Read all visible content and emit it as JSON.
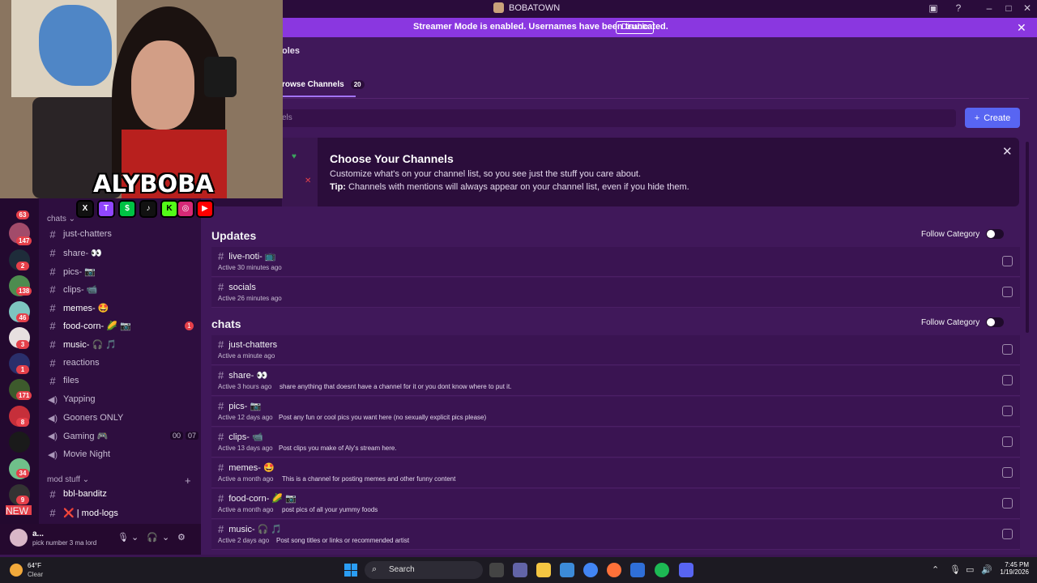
{
  "window": {
    "title": "BOBATOWN"
  },
  "banner": {
    "message": "Streamer Mode is enabled. Usernames have been truncated.",
    "disable_label": "Disable"
  },
  "header": {
    "tab_partial": "oles",
    "browse_tab_label": "rowse Channels",
    "browse_tab_count": "20",
    "search_placeholder": "els",
    "create_label": "Create"
  },
  "promo": {
    "title": "Choose Your Channels",
    "description": "Customize what's on your channel list, so you see just the stuff you care about.",
    "tip_label": "Tip:",
    "tip_text": "Channels with mentions will always appear on your channel list, even if you hide them."
  },
  "sections": [
    {
      "title": "Updates",
      "follow_label": "Follow Category",
      "rows": [
        {
          "name": "live-noti- 📺",
          "active": "Active 30 minutes ago",
          "topic": ""
        },
        {
          "name": "socials",
          "active": "Active 26 minutes ago",
          "topic": ""
        }
      ]
    },
    {
      "title": "chats",
      "follow_label": "Follow Category",
      "rows": [
        {
          "name": "just-chatters",
          "active": "Active a minute ago",
          "topic": ""
        },
        {
          "name": "share- 👀",
          "active": "Active 3 hours ago",
          "topic": "share anything that doesnt have a channel for it or you dont know where to put it."
        },
        {
          "name": "pics- 📷",
          "active": "Active 12 days ago",
          "topic": "Post any fun or cool pics you want here (no sexually explicit pics please)"
        },
        {
          "name": "clips- 📹",
          "active": "Active 13 days ago",
          "topic": "Post clips you make of Aly's stream here."
        },
        {
          "name": "memes- 🤩",
          "active": "Active a month ago",
          "topic": "This is a channel for posting memes and other funny content"
        },
        {
          "name": "food-corn- 🌽 📷",
          "active": "Active a month ago",
          "topic": "post pics of all your yummy foods"
        },
        {
          "name": "music- 🎧 🎵",
          "active": "Active 2 days ago",
          "topic": "Post song titles or links or recommended artist"
        }
      ]
    }
  ],
  "sidebar": {
    "category_chats": "chats",
    "category_mod": "mod stuff",
    "channels": [
      {
        "name": "just-chatters",
        "type": "text"
      },
      {
        "name": "share- 👀",
        "type": "text"
      },
      {
        "name": "pics- 📷",
        "type": "text"
      },
      {
        "name": "clips- 📹",
        "type": "text"
      },
      {
        "name": "memes- 🤩",
        "type": "text"
      },
      {
        "name": "food-corn- 🌽 📷",
        "type": "text",
        "unread": "1"
      },
      {
        "name": "music- 🎧 🎵",
        "type": "text"
      },
      {
        "name": "reactions",
        "type": "text"
      },
      {
        "name": "files",
        "type": "text"
      },
      {
        "name": "Yapping",
        "type": "voice"
      },
      {
        "name": "Gooners ONLY",
        "type": "voice"
      },
      {
        "name": "Gaming 🎮",
        "type": "voice",
        "count_a": "00",
        "count_b": "07"
      },
      {
        "name": "Movie Night",
        "type": "voice"
      }
    ],
    "mod_channels": [
      {
        "name": "bbl-banditz",
        "type": "text"
      },
      {
        "name": "❌ | mod-logs",
        "type": "text"
      }
    ]
  },
  "rail": {
    "badges": [
      "63",
      "147",
      "2",
      "138",
      "46",
      "3",
      "1",
      "171",
      "8",
      "34",
      "9"
    ],
    "new_label": "NEW"
  },
  "user": {
    "name": "a...",
    "status": "pick number 3 ma lord"
  },
  "overlay": {
    "streamer_name": "ALYBOBA",
    "social_icons": [
      "x-icon",
      "twitch-icon",
      "cashapp-icon",
      "tiktok-icon",
      "kick-icon",
      "instagram-icon",
      "youtube-icon"
    ]
  },
  "taskbar": {
    "temperature": "64°F",
    "condition": "Clear",
    "search_label": "Search",
    "time": "7:45 PM",
    "date": "1/19/2026"
  },
  "colors": {
    "banner": "#8a37e0",
    "accent": "#5865f2",
    "main_bg": "#40185a",
    "sidebar_bg": "#2e0e3f",
    "mention": "#e5404a"
  }
}
